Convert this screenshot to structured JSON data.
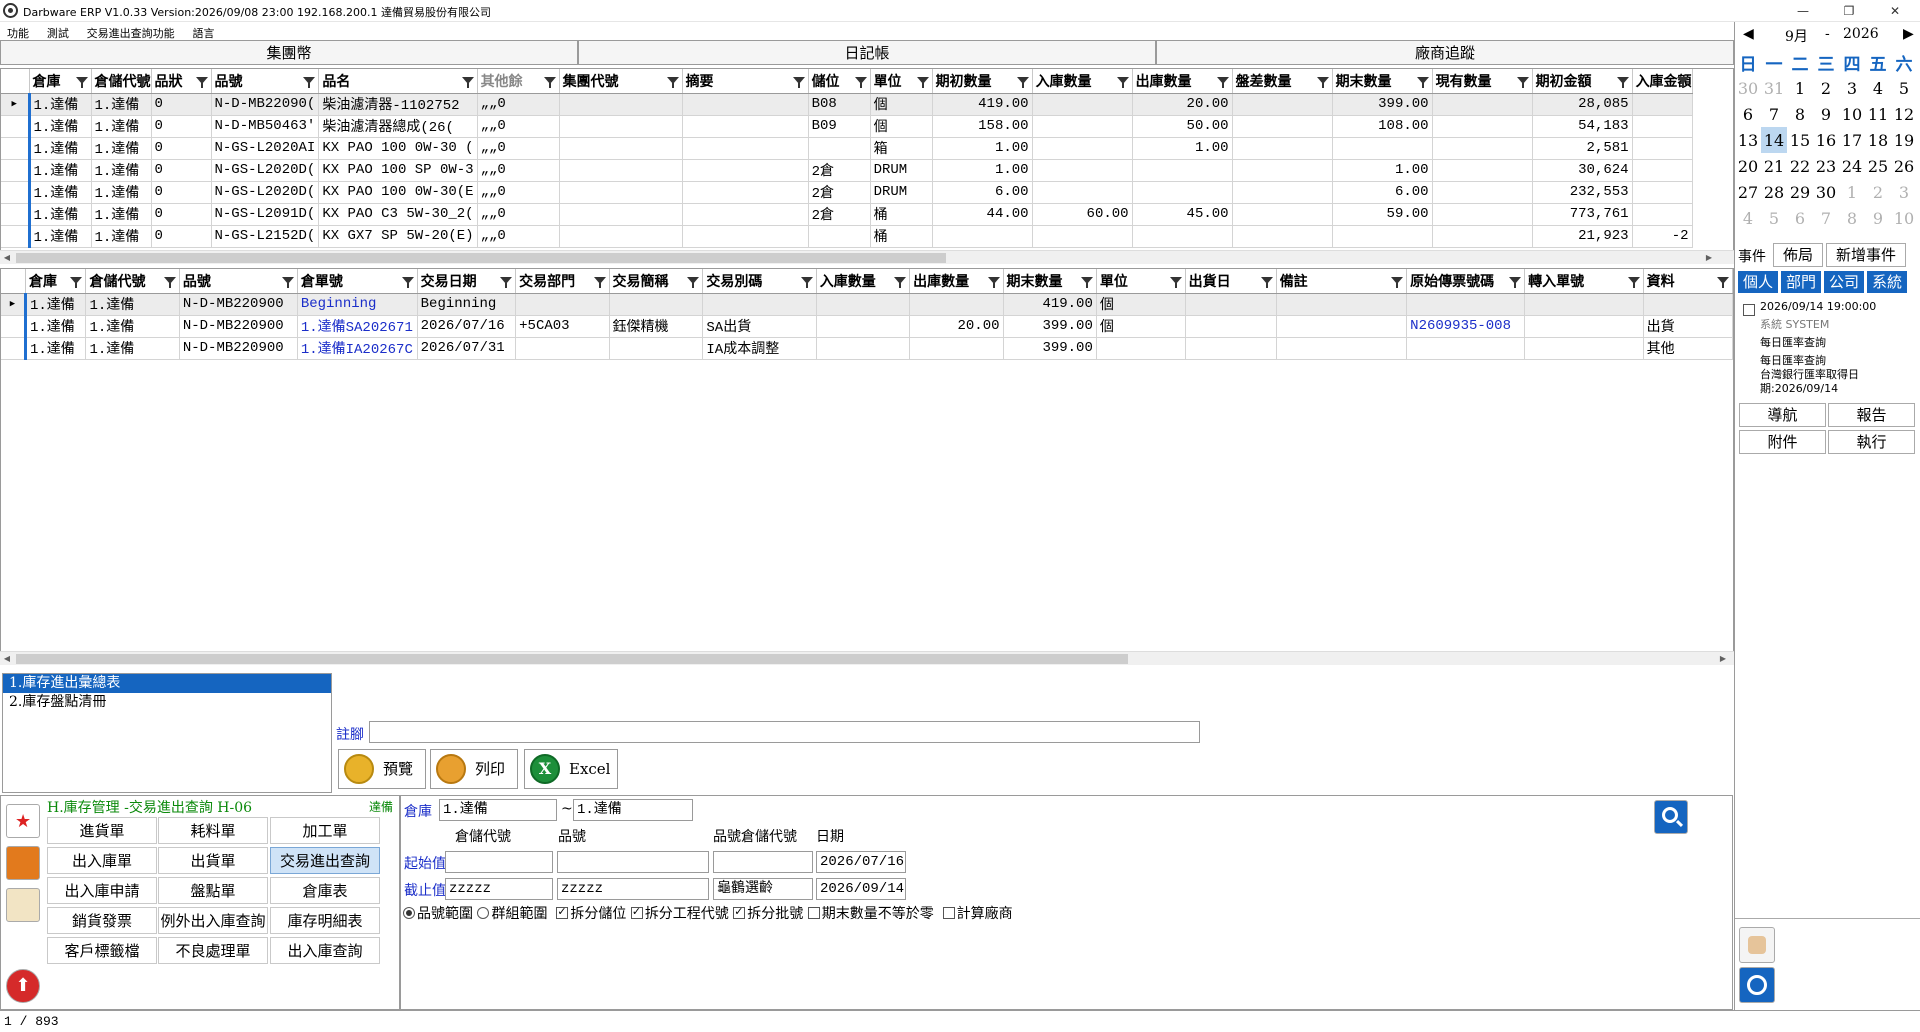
{
  "app": {
    "title": "Darbware ERP V1.0.33 Version:2026/09/08 23:00    192.168.200.1  達備貿易股份有限公司"
  },
  "menu": [
    "功能",
    "測試",
    "交易進出查詢功能",
    "語言"
  ],
  "tabs": [
    "集團幣",
    "日記帳",
    "廠商追蹤"
  ],
  "grid1": {
    "headers": [
      "倉庫",
      "倉儲代號",
      "品狀",
      "品號",
      "品名",
      "其他餘",
      "集團代號",
      "摘要",
      "儲位",
      "單位",
      "期初數量",
      "入庫數量",
      "出庫數量",
      "盤差數量",
      "期末數量",
      "現有數量",
      "期初金額",
      "入庫金額"
    ],
    "rows": [
      [
        "1.達備",
        "1.達備",
        "0",
        "N-D-MB22090(",
        "柴油濾清器-1102752",
        "„„0",
        "",
        "",
        "B08",
        "個",
        "419.00",
        "",
        "20.00",
        "",
        "399.00",
        "",
        "28,085",
        ""
      ],
      [
        "1.達備",
        "1.達備",
        "0",
        "N-D-MB50463'",
        "柴油濾清器總成(26(",
        "„„0",
        "",
        "",
        "B09",
        "個",
        "158.00",
        "",
        "50.00",
        "",
        "108.00",
        "",
        "54,183",
        ""
      ],
      [
        "1.達備",
        "1.達備",
        "0",
        "N-GS-L2020AI",
        "KX PAO 100 0W-30 (",
        "„„0",
        "",
        "",
        "",
        "箱",
        "1.00",
        "",
        "1.00",
        "",
        "",
        "",
        "2,581",
        ""
      ],
      [
        "1.達備",
        "1.達備",
        "0",
        "N-GS-L2020D(",
        "KX PAO 100 SP 0W-3",
        "„„0",
        "",
        "",
        "2倉",
        "DRUM",
        "1.00",
        "",
        "",
        "",
        "1.00",
        "",
        "30,624",
        ""
      ],
      [
        "1.達備",
        "1.達備",
        "0",
        "N-GS-L2020D(",
        "KX PAO 100 0W-30(E",
        "„„0",
        "",
        "",
        "2倉",
        "DRUM",
        "6.00",
        "",
        "",
        "",
        "6.00",
        "",
        "232,553",
        ""
      ],
      [
        "1.達備",
        "1.達備",
        "0",
        "N-GS-L2091D(",
        "KX PAO C3 5W-30_2(",
        "„„0",
        "",
        "",
        "2倉",
        "桶",
        "44.00",
        "60.00",
        "45.00",
        "",
        "59.00",
        "",
        "773,761",
        ""
      ],
      [
        "1.達備",
        "1.達備",
        "0",
        "N-GS-L2152D(",
        "KX GX7 SP 5W-20(E)",
        "„„0",
        "",
        "",
        "",
        "桶",
        "",
        "",
        "",
        "",
        "",
        "",
        "21,923",
        "-2"
      ]
    ]
  },
  "grid2": {
    "headers": [
      "倉庫",
      "倉儲代號",
      "品號",
      "倉單號",
      "交易日期",
      "交易部門",
      "交易簡稱",
      "交易別碼",
      "入庫數量",
      "出庫數量",
      "期末數量",
      "單位",
      "出貨日",
      "備註",
      "原始傳票號碼",
      "轉入單號",
      "資料"
    ],
    "rows": [
      [
        "1.達備",
        "1.達備",
        "N-D-MB220900",
        "Beginning",
        "Beginning",
        "",
        "",
        "",
        "",
        "",
        "419.00",
        "個",
        "",
        "",
        "",
        "",
        ""
      ],
      [
        "1.達備",
        "1.達備",
        "N-D-MB220900",
        "1.達備SA202671",
        "2026/07/16",
        "+5CA03",
        "鈺傑精機",
        "SA出貨",
        "",
        "20.00",
        "399.00",
        "個",
        "",
        "",
        "N2609935-008",
        "",
        "出貨"
      ],
      [
        "1.達備",
        "1.達備",
        "N-D-MB220900",
        "1.達備IA20267C",
        "2026/07/31",
        "",
        "",
        "IA成本調整",
        "",
        "",
        "399.00",
        "",
        "",
        "",
        "",
        "",
        "其他"
      ]
    ]
  },
  "reports": [
    "1.庫存進出彙總表",
    "2.庫存盤點清冊"
  ],
  "footer": {
    "label": "註腳",
    "preview": "預覽",
    "print": "列印",
    "excel": "Excel"
  },
  "module": {
    "title": "H.庫存管理 -交易進出查詢  H-06",
    "user": "達備",
    "buttons": [
      "進貨單",
      "耗料單",
      "加工單",
      "出入庫單",
      "出貨單",
      "交易進出查詢",
      "出入庫申請",
      "盤點單",
      "倉庫表",
      "銷貨發票",
      "例外出入庫查詢",
      "庫存明細表",
      "客戶標籤檔",
      "不良處理單",
      "出入庫查詢"
    ]
  },
  "query": {
    "warehouse_label": "倉庫",
    "wh_from": "1.達備",
    "wh_sep": "~",
    "wh_to": "1.達備",
    "col_storage": "倉儲代號",
    "col_item": "品號",
    "col_item_storage": "品號倉儲代號",
    "col_date": "日期",
    "start_label": "起始值",
    "end_label": "截止值",
    "start_date": "2026/07/16",
    "end_date": "2026/09/14",
    "end_storage": "zzzzz",
    "end_item": "zzzzz",
    "end_note": "龜鶴選齡",
    "opts": [
      "品號範圍",
      "群組範圍",
      "拆分儲位",
      "拆分工程代號",
      "拆分批號",
      "期末數量不等於零",
      "計算廠商"
    ]
  },
  "status": {
    "page": "1 / 893"
  },
  "calendar": {
    "month": "9月",
    "sep": "-",
    "year": "2026",
    "weekdays": [
      "日",
      "一",
      "二",
      "三",
      "四",
      "五",
      "六"
    ],
    "weeks": [
      [
        "30",
        "31",
        "1",
        "2",
        "3",
        "4",
        "5"
      ],
      [
        "6",
        "7",
        "8",
        "9",
        "10",
        "11",
        "12"
      ],
      [
        "13",
        "14",
        "15",
        "16",
        "17",
        "18",
        "19"
      ],
      [
        "20",
        "21",
        "22",
        "23",
        "24",
        "25",
        "26"
      ],
      [
        "27",
        "28",
        "29",
        "30",
        "1",
        "2",
        "3"
      ],
      [
        "4",
        "5",
        "6",
        "7",
        "8",
        "9",
        "10"
      ]
    ]
  },
  "events": {
    "label": "事件",
    "layout": "佈局",
    "add": "新增事件",
    "tabs": [
      "個人",
      "部門",
      "公司",
      "系統"
    ],
    "item_time": "2026/09/14 19:00:00",
    "item_user": "系統  SYSTEM",
    "item_title": "每日匯率查詢",
    "item_desc1": "每日匯率查詢",
    "item_desc2": "台灣銀行匯率取得日",
    "item_desc3": "期:2026/09/14"
  },
  "nav": [
    "導航",
    "報告",
    "附件",
    "執行"
  ]
}
